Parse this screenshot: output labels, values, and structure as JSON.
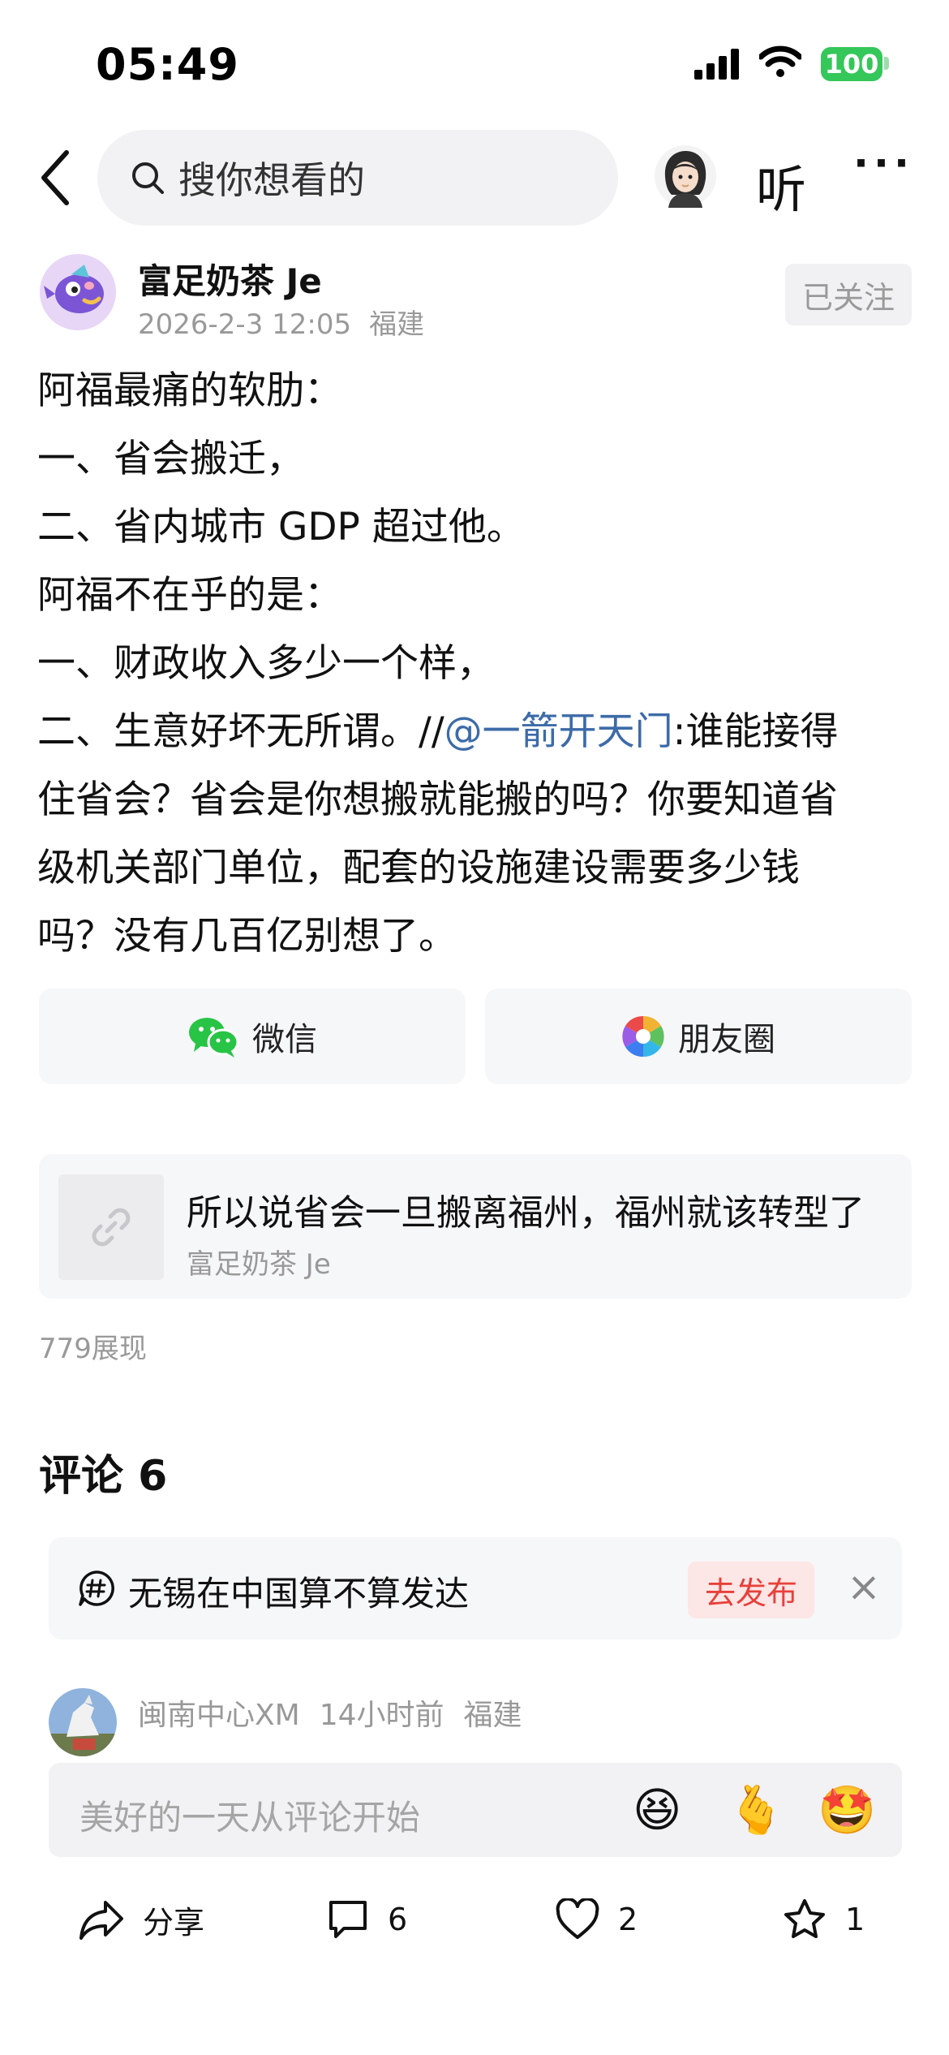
{
  "status_bar": {
    "time": "05:49",
    "battery": "100"
  },
  "nav": {
    "search_placeholder": "搜你想看的",
    "listen_label": "听",
    "more_label": "···"
  },
  "post": {
    "author": "富足奶茶 Je",
    "date": "2026-2-3 12:05",
    "location": "福建",
    "follow_label": "已关注",
    "lines": [
      "阿福最痛的软肋：",
      "一、省会搬迁，",
      "二、省内城市 GDP 超过他。",
      "阿福不在乎的是：",
      "一、财政收入多少一个样，"
    ],
    "line6_before": "二、生意好坏无所谓。//",
    "mention": "@一箭开天门",
    "line6_after": ":谁能接得",
    "lines_tail": [
      "住省会？省会是你想搬就能搬的吗？你要知道省",
      "级机关部门单位，配套的设施建设需要多少钱",
      "吗？没有几百亿别想了。"
    ]
  },
  "share": {
    "wechat_label": "微信",
    "moments_label": "朋友圈"
  },
  "link_card": {
    "title": "所以说省会一旦搬离福州，福州就该转型了",
    "author": "富足奶茶 Je"
  },
  "views": "779展现",
  "comments": {
    "title": "评论 6",
    "topic_text": "无锡在中国算不算发达",
    "publish_label": "去发布",
    "close_label": "×",
    "first_author": "闽南中心XM",
    "first_time": "14小时前",
    "first_location": "福建"
  },
  "comment_input": {
    "placeholder": "美好的一天从评论开始",
    "emoji": [
      "😆",
      "🫰",
      "🤩"
    ]
  },
  "bottom_bar": {
    "share_label": "分享",
    "comment_count": "6",
    "like_count": "2",
    "favorite_count": "1"
  },
  "colors": {
    "accent_link": "#3d6ba8",
    "publish_red": "#e8403b",
    "battery_green": "#34c759"
  }
}
